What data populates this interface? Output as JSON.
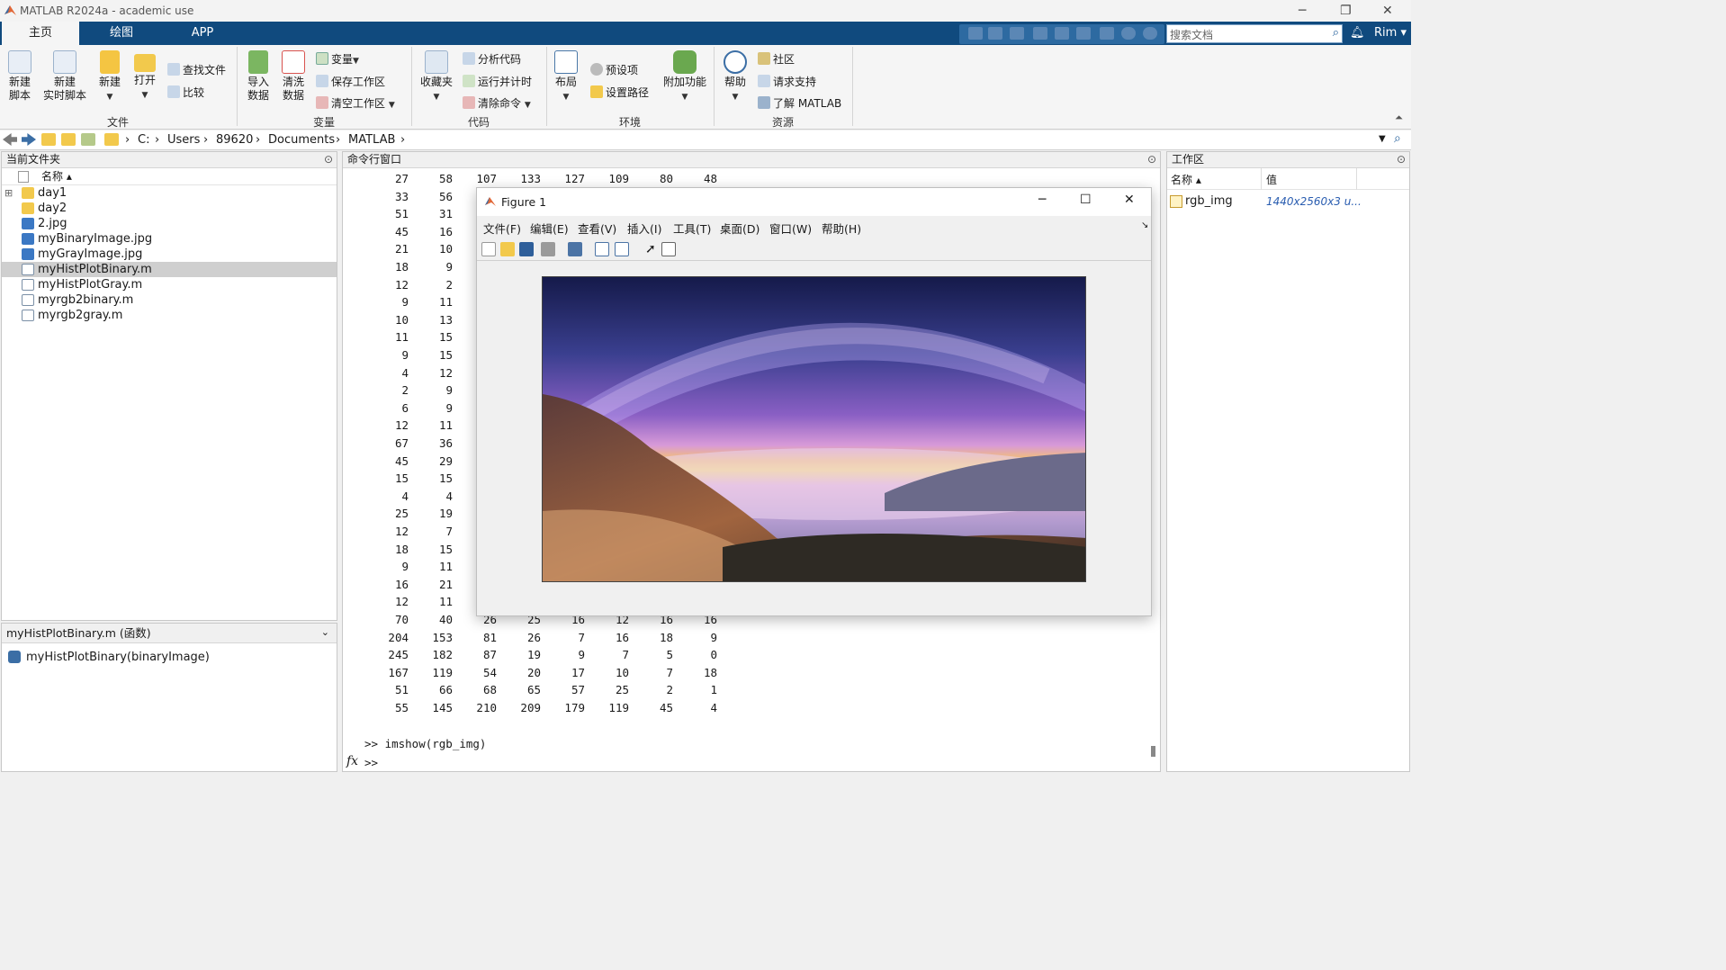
{
  "window": {
    "title": "MATLAB R2024a - academic use"
  },
  "tabs": [
    "主页",
    "绘图",
    "APP"
  ],
  "search": {
    "placeholder": "搜索文档"
  },
  "user": {
    "name": "Rim ▾"
  },
  "ribbon": {
    "file": {
      "group": "文件",
      "new_script": "新建\n脚本",
      "new_live_script": "新建\n实时脚本",
      "new": "新建",
      "open": "打开",
      "find_files": "查找文件",
      "compare": "比较"
    },
    "variable": {
      "group": "变量",
      "import": "导入\n数据",
      "clean": "清洗\n数据",
      "variable": "变量",
      "save_ws": "保存工作区",
      "clear_ws": "清空工作区"
    },
    "code": {
      "group": "代码",
      "favorites": "收藏夹",
      "analyze": "分析代码",
      "run_time": "运行并计时",
      "clear_cmd": "清除命令"
    },
    "env": {
      "group": "环境",
      "layout": "布局",
      "prefs": "预设项",
      "set_path": "设置路径",
      "addons": "附加功能"
    },
    "resources": {
      "group": "资源",
      "help": "帮助",
      "community": "社区",
      "support": "请求支持",
      "learn": "了解 MATLAB"
    }
  },
  "address": {
    "crumbs": [
      "C:",
      "Users",
      "89620",
      "Documents",
      "MATLAB"
    ]
  },
  "current_folder": {
    "title": "当前文件夹",
    "col_name": "名称 ▴",
    "items": [
      {
        "name": "day1",
        "type": "folder",
        "expand": "⊞"
      },
      {
        "name": "day2",
        "type": "folder",
        "expand": ""
      },
      {
        "name": "2.jpg",
        "type": "jpg",
        "expand": ""
      },
      {
        "name": "myBinaryImage.jpg",
        "type": "jpg",
        "expand": ""
      },
      {
        "name": "myGrayImage.jpg",
        "type": "jpg",
        "expand": ""
      },
      {
        "name": "myHistPlotBinary.m",
        "type": "m",
        "expand": "",
        "selected": true
      },
      {
        "name": "myHistPlotGray.m",
        "type": "m",
        "expand": ""
      },
      {
        "name": "myrgb2binary.m",
        "type": "m",
        "expand": ""
      },
      {
        "name": "myrgb2gray.m",
        "type": "m",
        "expand": ""
      }
    ],
    "details_title": "myHistPlotBinary.m  (函数)",
    "details_sig": "myHistPlotBinary(binaryImage)"
  },
  "command_window": {
    "title": "命令行窗口",
    "rows": [
      [
        "27",
        "58",
        "107",
        "133",
        "127",
        "109",
        "80",
        "48"
      ],
      [
        "33",
        "56",
        "",
        "",
        "",
        "",
        "",
        ""
      ],
      [
        "51",
        "31",
        "",
        "",
        "",
        "",
        "",
        ""
      ],
      [
        "45",
        "16",
        "",
        "",
        "",
        "",
        "",
        ""
      ],
      [
        "21",
        "10",
        "",
        "",
        "",
        "",
        "",
        ""
      ],
      [
        "18",
        "9",
        "",
        "",
        "",
        "",
        "",
        ""
      ],
      [
        "12",
        "2",
        "",
        "",
        "",
        "",
        "",
        ""
      ],
      [
        "9",
        "11",
        "",
        "",
        "",
        "",
        "",
        ""
      ],
      [
        "10",
        "13",
        "",
        "",
        "",
        "",
        "",
        ""
      ],
      [
        "11",
        "15",
        "",
        "",
        "",
        "",
        "",
        ""
      ],
      [
        "9",
        "15",
        "",
        "",
        "",
        "",
        "",
        ""
      ],
      [
        "4",
        "12",
        "",
        "",
        "",
        "",
        "",
        ""
      ],
      [
        "2",
        "9",
        "",
        "",
        "",
        "",
        "",
        ""
      ],
      [
        "6",
        "9",
        "",
        "",
        "",
        "",
        "",
        ""
      ],
      [
        "12",
        "11",
        "",
        "",
        "",
        "",
        "",
        ""
      ],
      [
        "67",
        "36",
        "",
        "",
        "",
        "",
        "",
        ""
      ],
      [
        "45",
        "29",
        "",
        "",
        "",
        "",
        "",
        ""
      ],
      [
        "15",
        "15",
        "",
        "",
        "",
        "",
        "",
        ""
      ],
      [
        "4",
        "4",
        "",
        "",
        "",
        "",
        "",
        ""
      ],
      [
        "25",
        "19",
        "",
        "",
        "",
        "",
        "",
        ""
      ],
      [
        "12",
        "7",
        "",
        "",
        "",
        "",
        "",
        ""
      ],
      [
        "18",
        "15",
        "",
        "",
        "",
        "",
        "",
        ""
      ],
      [
        "9",
        "11",
        "",
        "",
        "",
        "",
        "",
        ""
      ],
      [
        "16",
        "21",
        "",
        "",
        "",
        "",
        "",
        ""
      ],
      [
        "12",
        "11",
        "",
        "",
        "",
        "",
        "",
        ""
      ],
      [
        "70",
        "40",
        "26",
        "25",
        "16",
        "12",
        "16",
        "16"
      ],
      [
        "204",
        "153",
        "81",
        "26",
        "7",
        "16",
        "18",
        "9"
      ],
      [
        "245",
        "182",
        "87",
        "19",
        "9",
        "7",
        "5",
        "0"
      ],
      [
        "167",
        "119",
        "54",
        "20",
        "17",
        "10",
        "7",
        "18"
      ],
      [
        "51",
        "66",
        "68",
        "65",
        "57",
        "25",
        "2",
        "1"
      ],
      [
        "55",
        "145",
        "210",
        "209",
        "179",
        "119",
        "45",
        "4"
      ]
    ],
    "last_command": ">> imshow(rgb_img)",
    "prompt": ">>",
    "fx": "fx"
  },
  "workspace": {
    "title": "工作区",
    "col_name": "名称 ▴",
    "col_value": "值",
    "vars": [
      {
        "name": "rgb_img",
        "value": "1440x2560x3 u..."
      }
    ]
  },
  "figure": {
    "title": "Figure 1",
    "menu": [
      "文件(F)",
      "编辑(E)",
      "查看(V)",
      "插入(I)",
      "工具(T)",
      "桌面(D)",
      "窗口(W)",
      "帮助(H)"
    ]
  }
}
